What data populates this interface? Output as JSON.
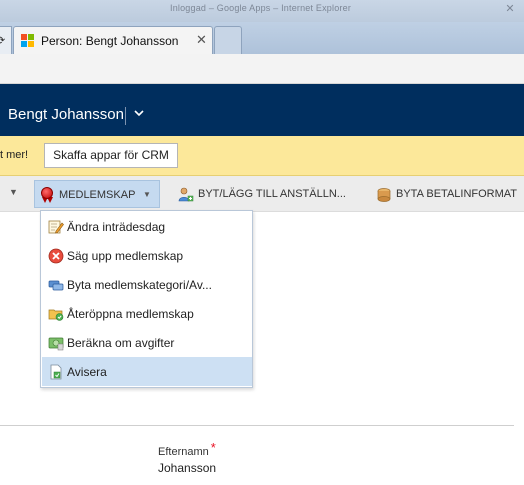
{
  "browser": {
    "window_title": "Inloggad – Google Apps – Internet Explorer",
    "tab": {
      "title": "Person: Bengt Johansson"
    }
  },
  "crm": {
    "record_name": "Bengt Johansson",
    "header_color": "#002e5e"
  },
  "notification": {
    "text": "t mer!",
    "button_label": "Skaffa appar för CRM",
    "background": "#fce89a"
  },
  "command_bar": {
    "items": [
      {
        "label": "MEDLEMSKAP",
        "icon": "ribbon-icon",
        "has_dropdown": true,
        "active": true
      },
      {
        "label": "BYT/LÄGG TILL ANSTÄLLN...",
        "icon": "person-add-icon"
      },
      {
        "label": "BYTA BETALINFORMAT",
        "icon": "coins-icon"
      }
    ]
  },
  "menu": {
    "items": [
      {
        "label": "Ändra inträdesdag",
        "icon": "edit-form-icon"
      },
      {
        "label": "Säg upp medlemskap",
        "icon": "cancel-icon"
      },
      {
        "label": "Byta medlemskategori/Av...",
        "icon": "swap-category-icon"
      },
      {
        "label": "Återöppna medlemskap",
        "icon": "reopen-folder-icon"
      },
      {
        "label": "Beräkna om avgifter",
        "icon": "calculate-fees-icon"
      },
      {
        "label": "Avisera",
        "icon": "notify-document-icon",
        "highlighted": true
      }
    ]
  },
  "form": {
    "field_label": "Efternamn",
    "required_marker": "*",
    "field_value": "Johansson"
  }
}
